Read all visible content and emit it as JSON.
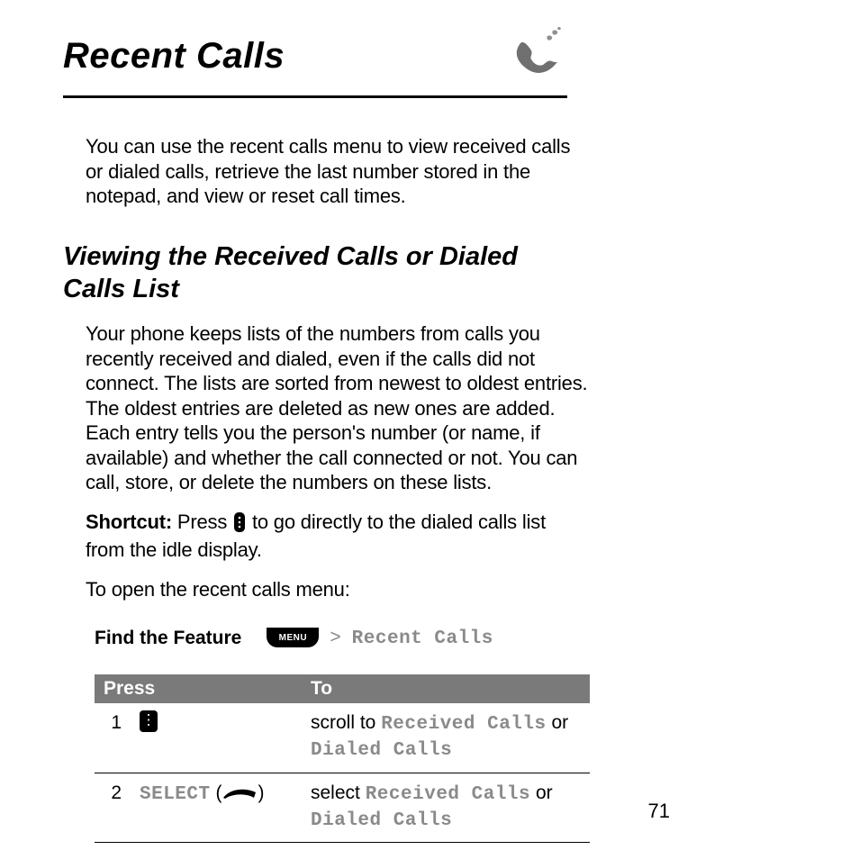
{
  "title": "Recent Calls",
  "intro": "You can use the recent calls menu to view received calls or dialed calls, retrieve the last number stored in the notepad, and view or reset call times.",
  "section": {
    "heading": "Viewing the Received Calls or Dialed Calls List",
    "paragraph": "Your phone keeps lists of the numbers from calls you recently received and dialed, even if the calls did not connect. The lists are sorted from newest to oldest entries. The oldest entries are deleted as new ones are added. Each entry tells you the person's number (or name, if available) and whether the call connected or not. You can call, store, or delete the numbers on these lists.",
    "shortcut_label": "Shortcut:",
    "shortcut_before": " Press ",
    "shortcut_after": " to go directly to the dialed calls list from the idle display.",
    "open_note": "To open the recent calls menu:"
  },
  "find": {
    "label": "Find the Feature",
    "menu_key_text": "MENU",
    "sep": ">",
    "target": "Recent Calls"
  },
  "table": {
    "headers": {
      "press": "Press",
      "to": "To"
    },
    "rows": [
      {
        "num": "1",
        "press": {
          "type": "nav-key"
        },
        "to_pre": "scroll to ",
        "to_ui1": "Received Calls",
        "to_mid": " or ",
        "to_ui2": "Dialed Calls"
      },
      {
        "num": "2",
        "press": {
          "type": "select",
          "label": "SELECT",
          "paren_open": " (",
          "paren_close": ")"
        },
        "to_pre": "select ",
        "to_ui1": "Received Calls",
        "to_mid": " or ",
        "to_ui2": "Dialed Calls"
      }
    ]
  },
  "page_number": "71"
}
